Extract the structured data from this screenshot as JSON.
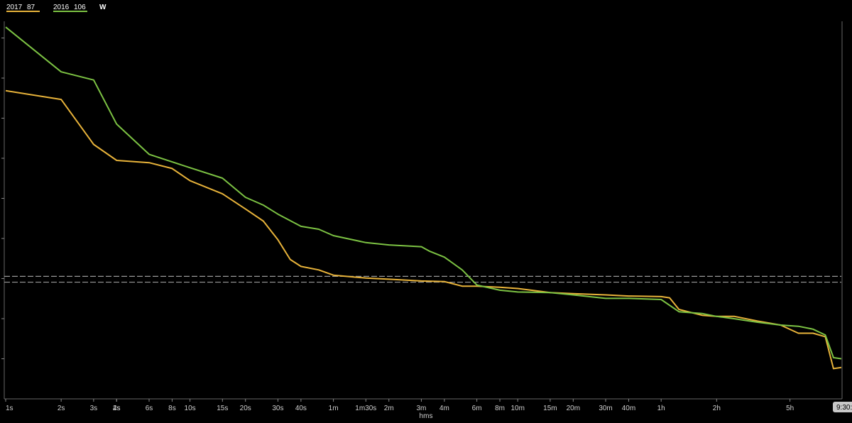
{
  "chart_data": {
    "type": "line",
    "x_scale": "log",
    "xlabel": "hms",
    "ylabel": "",
    "unit": "W",
    "ylim": [
      0,
      1
    ],
    "grid": false,
    "legend_position": "top-left",
    "cursor_label": "9:30:",
    "x_ticks": [
      "1s",
      "2s",
      "2s",
      "3s",
      "4s",
      "6s",
      "8s",
      "10s",
      "15s",
      "20s",
      "30s",
      "40s",
      "1m",
      "1m30s",
      "2m",
      "3m",
      "4m",
      "6m",
      "8m",
      "10m",
      "15m",
      "20m",
      "30m",
      "40m",
      "1h",
      "2h",
      "5h"
    ],
    "x_tick_seconds": [
      1,
      2,
      2,
      3,
      4,
      6,
      8,
      10,
      15,
      20,
      30,
      40,
      60,
      90,
      120,
      180,
      240,
      360,
      480,
      600,
      900,
      1200,
      1800,
      2400,
      3600,
      7200,
      18000
    ],
    "x_range_seconds": [
      1,
      34200
    ],
    "reference_lines": [
      0.3245,
      0.3091
    ],
    "series": [
      {
        "name": "2017",
        "legend_value": "87",
        "color": "#e8b33a",
        "x": [
          1,
          2,
          3,
          4,
          6,
          8,
          10,
          15,
          20,
          25,
          30,
          35,
          40,
          50,
          60,
          90,
          120,
          180,
          240,
          300,
          360,
          480,
          600,
          900,
          1200,
          1800,
          2400,
          3600,
          4000,
          4500,
          6000,
          7200,
          9000,
          12000,
          16000,
          20000,
          24000,
          28000,
          31000,
          34200
        ],
        "y": [
          0.8162,
          0.7931,
          0.6739,
          0.6316,
          0.6255,
          0.6101,
          0.5778,
          0.5431,
          0.5031,
          0.4708,
          0.4215,
          0.3692,
          0.3508,
          0.3415,
          0.3277,
          0.32,
          0.3169,
          0.3123,
          0.3108,
          0.2985,
          0.2985,
          0.2954,
          0.2923,
          0.2815,
          0.2785,
          0.2754,
          0.2723,
          0.2708,
          0.2677,
          0.2369,
          0.2215,
          0.2185,
          0.2185,
          0.2062,
          0.1954,
          0.1738,
          0.1738,
          0.1646,
          0.08,
          0.083
        ]
      },
      {
        "name": "2016",
        "legend_value": "106",
        "color": "#7cc243",
        "x": [
          1,
          2,
          3,
          4,
          6,
          8,
          10,
          15,
          20,
          25,
          30,
          40,
          50,
          60,
          90,
          120,
          180,
          200,
          240,
          300,
          360,
          480,
          600,
          900,
          1200,
          1800,
          2400,
          3600,
          4500,
          6000,
          7200,
          9000,
          12000,
          16000,
          20000,
          24000,
          28000,
          31000,
          34200
        ],
        "y": [
          0.9846,
          0.8662,
          0.8446,
          0.7277,
          0.6477,
          0.6277,
          0.6123,
          0.5846,
          0.5339,
          0.5131,
          0.4892,
          0.4569,
          0.4492,
          0.4323,
          0.4139,
          0.4077,
          0.4031,
          0.3908,
          0.3754,
          0.3415,
          0.3015,
          0.2877,
          0.2831,
          0.2815,
          0.2754,
          0.2662,
          0.2662,
          0.2631,
          0.2308,
          0.2262,
          0.2185,
          0.2123,
          0.2031,
          0.1954,
          0.1923,
          0.1846,
          0.1692,
          0.1092,
          0.1062
        ]
      }
    ]
  }
}
